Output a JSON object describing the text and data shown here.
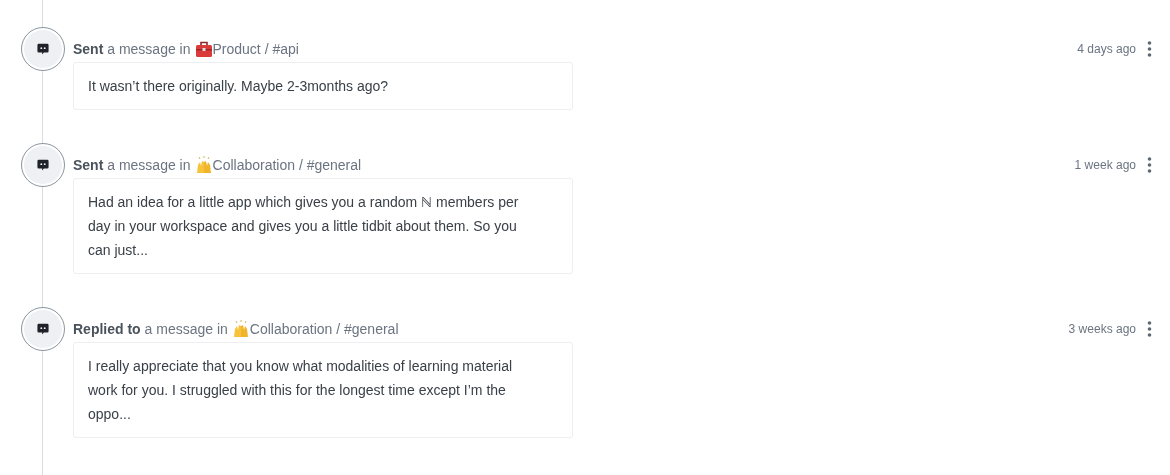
{
  "activities": [
    {
      "action": "**Sent** a message in",
      "kind": "toolbox",
      "channel": "Product / #api",
      "time": "4 days ago",
      "message": "It wasn’t there originally. Maybe 2-3months ago?"
    },
    {
      "action": "**Sent** a message in",
      "kind": "raised-hands",
      "channel": "Collaboration / #general",
      "time": "1 week ago",
      "message": "Had an idea for a little app which gives you a random ℕ members per day in your workspace and gives you a little tidbit about them. So you can just..."
    },
    {
      "action": "**Replied to** a message in",
      "kind": "raised-hands",
      "channel": "Collaboration / #general",
      "time": "3 weeks ago",
      "message": "I really appreciate that you know what modalities of learning material work for you. I struggled with this for the longest time except I’m the oppo..."
    }
  ]
}
